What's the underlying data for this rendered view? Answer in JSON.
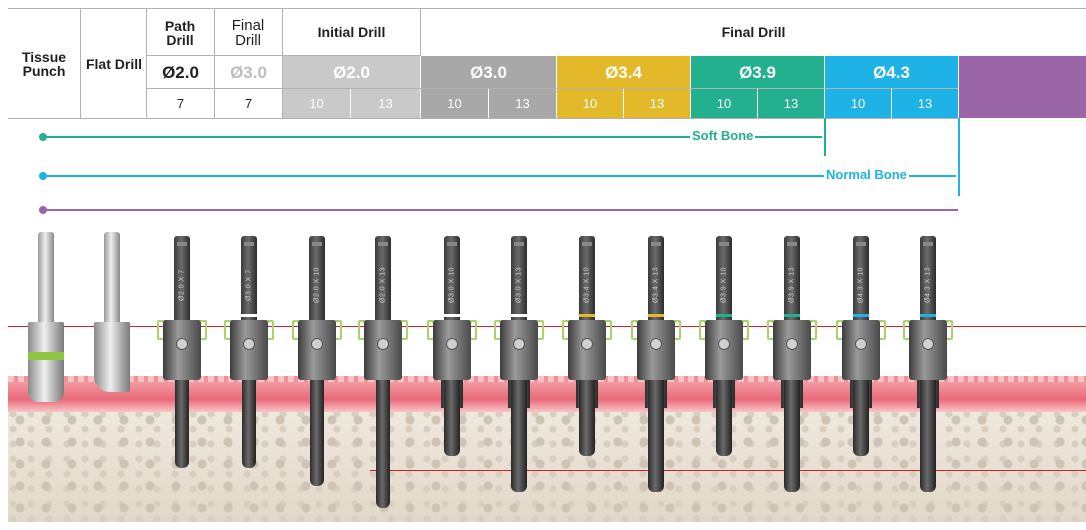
{
  "header": {
    "tissue_punch": "Tissue Punch",
    "flat_drill": "Flat Drill",
    "path_drill": "Path Drill",
    "final_drill_small": "Final Drill",
    "initial_drill": "Initial Drill",
    "final_drill": "Final Drill",
    "diameters": [
      "Ø2.0",
      "Ø3.0",
      "Ø2.0",
      "Ø3.0",
      "Ø3.4",
      "Ø3.9",
      "Ø4.3"
    ],
    "path_len": "7",
    "final_len": "7",
    "lengths": [
      "10",
      "13",
      "10",
      "13",
      "10",
      "13",
      "10",
      "13",
      "10",
      "13"
    ]
  },
  "colors": {
    "initial": "#c9c9c9",
    "d30": "#a8a8a8",
    "d34": "#e3b92a",
    "d39": "#22b08e",
    "d43": "#1eb3e6",
    "extra": "#9a66a8",
    "soft": "#22b08e",
    "normal": "#1eb3e6",
    "hard": "#9a66a8"
  },
  "bone_labels": {
    "soft": "Soft Bone",
    "normal": "Normal Bone"
  },
  "tools": [
    {
      "label": "Ø2.0 X 7",
      "ring": "none"
    },
    {
      "label": "Ø3.0 X 7",
      "ring": "#ffffff"
    },
    {
      "label": "Ø2.0 X 10",
      "ring": "none"
    },
    {
      "label": "Ø2.0 X 13",
      "ring": "none"
    },
    {
      "label": "Ø3.0 X 10",
      "ring": "#ffffff"
    },
    {
      "label": "Ø3.0 X 13",
      "ring": "#ffffff"
    },
    {
      "label": "Ø3.4 X 10",
      "ring": "#e3b92a"
    },
    {
      "label": "Ø3.4 X 13",
      "ring": "#e3b92a"
    },
    {
      "label": "Ø3.9 X 10",
      "ring": "#22b08e"
    },
    {
      "label": "Ø3.9 X 13",
      "ring": "#22b08e"
    },
    {
      "label": "Ø4.3 X 10",
      "ring": "#1eb3e6"
    },
    {
      "label": "Ø4.3 X 13",
      "ring": "#1eb3e6"
    }
  ]
}
